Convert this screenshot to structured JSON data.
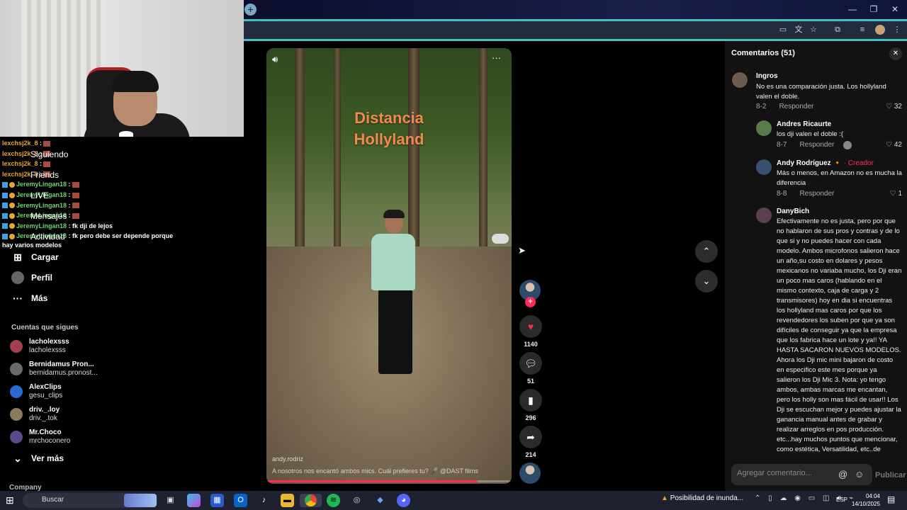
{
  "window": {
    "new_tab_glyph": "+",
    "minimize": "—",
    "restore": "❐",
    "close": "✕"
  },
  "chat": {
    "lines": [
      {
        "user": "lexchsj2k_8",
        "sep": " :",
        "msg": "",
        "color": "orange",
        "emote": true,
        "ghost": ""
      },
      {
        "user": "lexchsj2k_8",
        "sep": " :",
        "msg": "",
        "color": "orange",
        "emote": true,
        "ghost": "Siguiendo"
      },
      {
        "user": "lexchsj2k_8",
        "sep": " :",
        "msg": "",
        "color": "orange",
        "emote": true,
        "ghost": ""
      },
      {
        "user": "lexchsj2k_8",
        "sep": " :",
        "msg": "",
        "color": "orange",
        "emote": true,
        "ghost": "Friends"
      },
      {
        "user": "JeremyLingan18",
        "sep": " :",
        "msg": "",
        "color": "green",
        "emote": true,
        "ghost": ""
      },
      {
        "user": "JeremyLingan18",
        "sep": " :",
        "msg": "",
        "color": "green",
        "emote": true,
        "ghost": "LIVE"
      },
      {
        "user": "JeremyLingan18",
        "sep": " :",
        "msg": "",
        "color": "green",
        "emote": true,
        "ghost": ""
      },
      {
        "user": "JeremyLingan18",
        "sep": " :",
        "msg": "",
        "color": "green",
        "emote": true,
        "ghost": "Mensajes"
      },
      {
        "user": "JeremyLingan18",
        "sep": " :",
        "msg": " fk dji de lejos",
        "color": "green",
        "emote": false,
        "ghost": ""
      },
      {
        "user": "JeremyLingan18",
        "sep": " :",
        "msg": " fk pero debe ser depende porque",
        "color": "green",
        "emote": false,
        "ghost": "Actividad"
      }
    ],
    "wrap_line": "hay varios modelos"
  },
  "sidebar": {
    "items": [
      {
        "icon": "⊞",
        "label": "Cargar"
      },
      {
        "icon": "◉",
        "label": "Perfil"
      },
      {
        "icon": "···",
        "label": "Más"
      }
    ],
    "following_title": "Cuentas que sigues",
    "following": [
      {
        "name": "lacholexsss",
        "handle": "lacholexsss",
        "color": "#a04050"
      },
      {
        "name": "Bernidamus Pron...",
        "handle": "bernidamus.pronost...",
        "color": "#6a6a6a"
      },
      {
        "name": "AlexClips",
        "handle": "gesu_clips",
        "color": "#2a6ad0"
      },
      {
        "name": "driv._.loy",
        "handle": "driv._.tok",
        "color": "#8a7a60"
      },
      {
        "name": "Mr.Choco",
        "handle": "mrchoconero",
        "color": "#5a4a8a"
      }
    ],
    "see_more": "Ver más",
    "see_more_icon": "⌄",
    "company": "Company"
  },
  "video": {
    "title_line1": "Distancia",
    "title_line2": "Hollyland",
    "author": "andy.rodriz",
    "caption": "A nosotros nos encantó ambos mics. Cuál prefieres tu? 🎤 @DAST films",
    "progress": 0.86
  },
  "actions": {
    "likes": "1140",
    "comments": "51",
    "saves": "296",
    "shares": "214"
  },
  "comments_panel": {
    "title": "Comentarios (51)",
    "close": "✕",
    "reply_label": "Responder",
    "items": [
      {
        "user": "Ingros",
        "creator": "",
        "text": "No es una comparación justa. Los hollyland valen el doble.",
        "date": "8-2",
        "likes": "32",
        "avatar": "#6a5a50"
      },
      {
        "user": "Andres Ricaurte",
        "creator": "",
        "text": "los dji valen el doble :(",
        "date": "8-7",
        "likes": "42",
        "avatar": "#5a7a4a"
      },
      {
        "user": "Andy Rodríguez 🔸",
        "creator": "· Creador",
        "text": "Más o menos, en Amazon no es mucha la diferencia",
        "date": "8-8",
        "likes": "1",
        "avatar": "#3a5070"
      },
      {
        "user": "DanyBich",
        "creator": "",
        "text": "Efectivamente no es justa, pero por que no hablaron de sus pros y contras y de lo que si y no puedes hacer con cada modelo. Ambos microfonos salieron hace un año,su costo en dolares y pesos mexicanos no variaba mucho, los Dji eran un poco mas caros (hablando en el mismo contexto, caja de carga y 2 transmisores) hoy en dia si encuentras los hollyland mas caros por que los revendedores los suben por que ya son difíciles de conseguir ya que la empresa que los fabrica hace un lote y ya!! YA HASTA SACARON NUEVOS MODELOS. Ahora los Dji mic mini bajaron de costo en especifico este mes porque ya salieron los Dji Mic 3. Nota: yo tengo ambos, ambas marcas me encantan, pero los holly son mas fácil de usar!! Los Dji se escuchan mejor y puedes ajustar la ganancia manual antes de grabar y realizar arreglos en pos producción. etc...hay muchos puntos que mencionar, como estética, Versatilidad, etc..de",
        "date": "",
        "likes": "",
        "avatar": "#5a4050"
      }
    ],
    "input_placeholder": "Agregar comentario...",
    "post_label": "Publicar"
  },
  "taskbar": {
    "search_placeholder": "Buscar",
    "weather": "Posibilidad de inunda...",
    "lang": "ESP",
    "time": "04:04",
    "date": "14/10/2025"
  }
}
